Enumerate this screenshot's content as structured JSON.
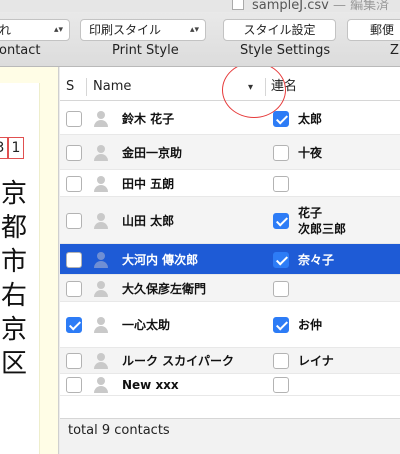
{
  "window": {
    "title": "sampleJ.csv",
    "title_suffix": "— 編集済"
  },
  "toolbar": {
    "items": [
      {
        "value": "れ",
        "label": "ontact"
      },
      {
        "value": "印刷スタイル",
        "label": "Print Style"
      },
      {
        "value": "スタイル設定",
        "label": "Style Settings"
      },
      {
        "value": "郵便",
        "label": "Z"
      }
    ]
  },
  "preview": {
    "postal_digits": [
      "3",
      "1"
    ],
    "address_vertical": [
      "京",
      "都",
      "市",
      "右",
      "京",
      "区"
    ]
  },
  "table": {
    "columns": {
      "select": "S",
      "name": "Name",
      "renmei": "連名"
    },
    "rows": [
      {
        "selected": false,
        "name": "鈴木 花子",
        "renmei_checked": true,
        "renmei": "太郎"
      },
      {
        "selected": false,
        "name": "金田一京助",
        "renmei_checked": false,
        "renmei": "十夜"
      },
      {
        "selected": false,
        "name": "田中 五朗",
        "renmei_checked": false,
        "renmei": ""
      },
      {
        "selected": false,
        "name": "山田 太郎",
        "renmei_checked": true,
        "renmei": "花子\n次郎三郎"
      },
      {
        "selected": false,
        "name": "大河内 傳次郎",
        "renmei_checked": true,
        "renmei": "奈々子",
        "highlighted": true
      },
      {
        "selected": false,
        "name": "大久保彦左衛門",
        "renmei_checked": false,
        "renmei": ""
      },
      {
        "selected": true,
        "name": "一心太助",
        "renmei_checked": true,
        "renmei": "お仲"
      },
      {
        "selected": false,
        "name": "ルーク スカイパーク",
        "renmei_checked": false,
        "renmei": "レイナ"
      },
      {
        "selected": false,
        "name": "New xxx",
        "renmei_checked": false,
        "renmei": ""
      }
    ],
    "footer": "total 9 contacts"
  },
  "colors": {
    "selection": "#1e5bd6",
    "checkbox": "#2d7cf6",
    "annotation": "#e63b3b"
  }
}
